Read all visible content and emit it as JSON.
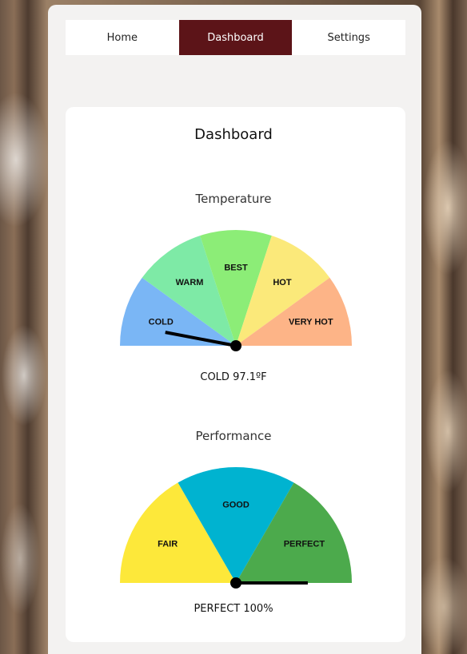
{
  "nav": {
    "tabs": [
      {
        "label": "Home",
        "active": false
      },
      {
        "label": "Dashboard",
        "active": true
      },
      {
        "label": "Settings",
        "active": false
      }
    ]
  },
  "dashboard": {
    "title": "Dashboard"
  },
  "temperature": {
    "title": "Temperature",
    "reading": "COLD 97.1ºF",
    "needle_fraction": 0.06,
    "segments": [
      {
        "label": "COLD",
        "color": "#7ab6f5"
      },
      {
        "label": "WARM",
        "color": "#7eeaa6"
      },
      {
        "label": "BEST",
        "color": "#8ced77"
      },
      {
        "label": "HOT",
        "color": "#fbe97a"
      },
      {
        "label": "VERY HOT",
        "color": "#fdb487"
      }
    ]
  },
  "performance": {
    "title": "Performance",
    "reading": "PERFECT 100%",
    "needle_fraction": 1.0,
    "segments": [
      {
        "label": "FAIR",
        "color": "#fde83a"
      },
      {
        "label": "GOOD",
        "color": "#00b3d0"
      },
      {
        "label": "PERFECT",
        "color": "#4caa4c"
      }
    ]
  },
  "colors": {
    "nav_active": "#5c1418",
    "needle": "#000000"
  }
}
